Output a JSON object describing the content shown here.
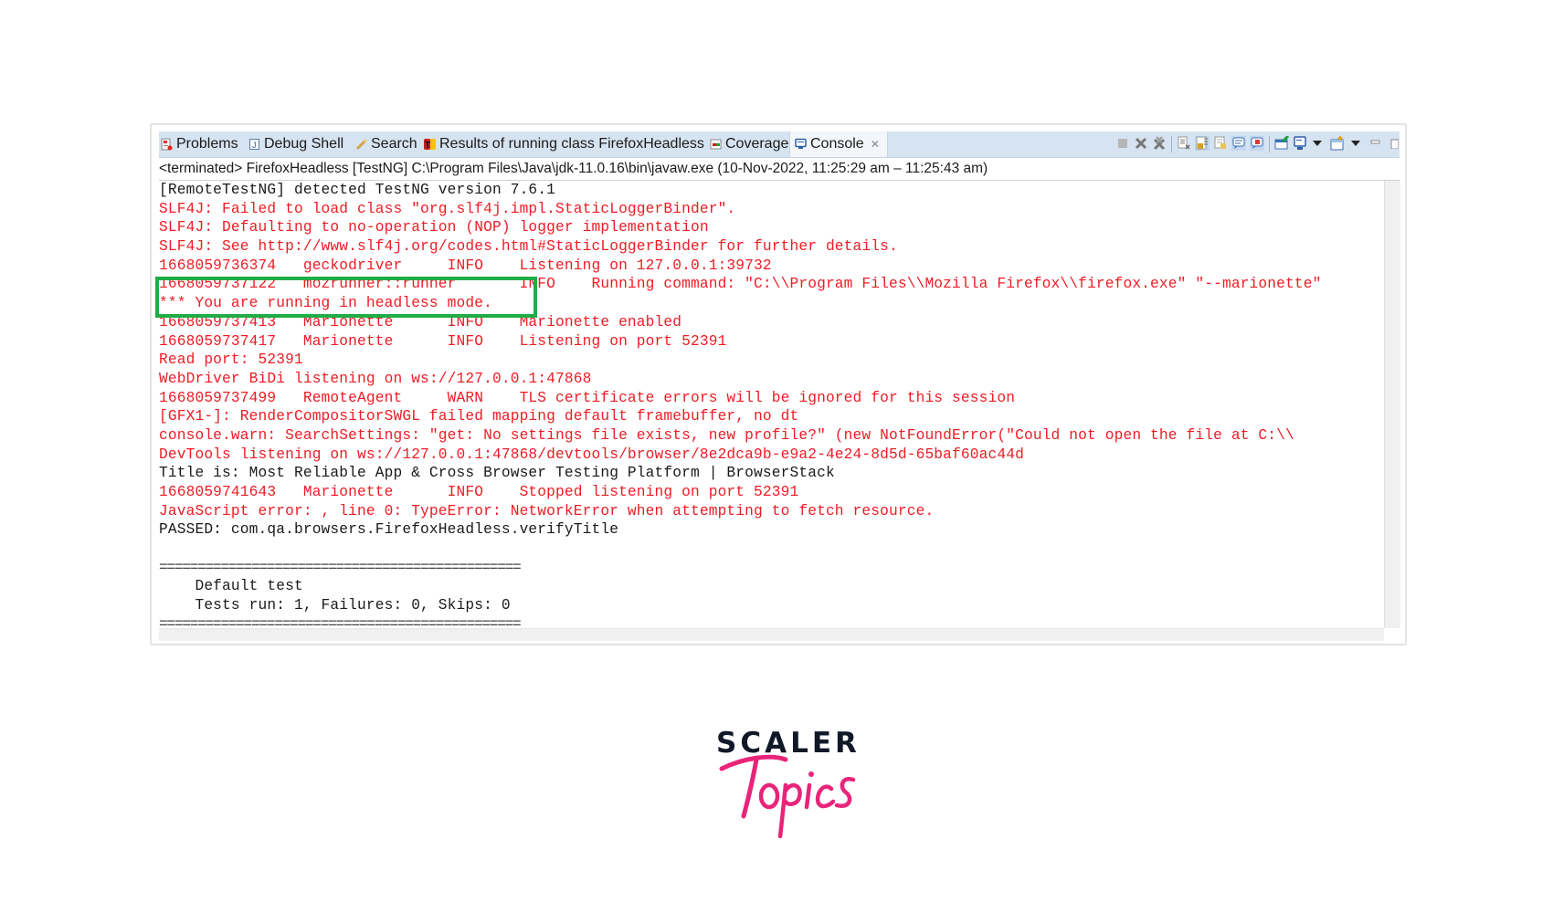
{
  "tabs": [
    {
      "label": "Problems",
      "icon": "problems-icon",
      "active": false
    },
    {
      "label": "Debug Shell",
      "icon": "debug-shell-icon",
      "active": false
    },
    {
      "label": "Search",
      "icon": "search-icon",
      "active": false
    },
    {
      "label": "Results of running class FirefoxHeadless",
      "icon": "testng-results-icon",
      "active": false
    },
    {
      "label": "Coverage",
      "icon": "coverage-icon",
      "active": false
    },
    {
      "label": "Console",
      "icon": "console-icon",
      "active": true,
      "close": "✕"
    }
  ],
  "toolbar": [
    {
      "name": "terminate-icon",
      "glyph": "■"
    },
    {
      "name": "remove-launch-icon",
      "glyph": "✖"
    },
    {
      "name": "remove-all-terminated-icon",
      "glyph": "✖"
    },
    {
      "name": "clear-console-icon",
      "glyph": "☰"
    },
    {
      "name": "scroll-lock-icon",
      "glyph": "☰"
    },
    {
      "name": "word-wrap-icon",
      "glyph": "☰"
    },
    {
      "name": "show-on-stdout-icon",
      "glyph": "▤"
    },
    {
      "name": "show-on-stderr-icon",
      "glyph": "▤"
    },
    {
      "name": "pin-console-icon",
      "glyph": "▬"
    },
    {
      "name": "display-console-icon",
      "glyph": "▣"
    },
    {
      "name": "display-console-dropdown-icon",
      "glyph": "▼"
    },
    {
      "name": "open-console-icon",
      "glyph": "□"
    },
    {
      "name": "open-console-dropdown-icon",
      "glyph": "▼"
    },
    {
      "name": "minimize-icon",
      "glyph": "−"
    },
    {
      "name": "maximize-icon",
      "glyph": "▯"
    }
  ],
  "status": "<terminated> FirefoxHeadless [TestNG] C:\\Program Files\\Java\\jdk-11.0.16\\bin\\javaw.exe  (10-Nov-2022, 11:25:29 am – 11:25:43 am)",
  "console_lines": [
    {
      "text": "[RemoteTestNG] detected TestNG version 7.6.1",
      "color": "black"
    },
    {
      "text": "SLF4J: Failed to load class \"org.slf4j.impl.StaticLoggerBinder\".",
      "color": "red"
    },
    {
      "text": "SLF4J: Defaulting to no-operation (NOP) logger implementation",
      "color": "red"
    },
    {
      "text": "SLF4J: See http://www.slf4j.org/codes.html#StaticLoggerBinder for further details.",
      "color": "red"
    },
    {
      "text": "1668059736374   geckodriver     INFO    Listening on 127.0.0.1:39732",
      "color": "red"
    },
    {
      "text": "1668059737122   mozrunner::runner       INFO    Running command: \"C:\\\\Program Files\\\\Mozilla Firefox\\\\firefox.exe\" \"--marionette\"",
      "color": "red"
    },
    {
      "text": "*** You are running in headless mode.",
      "color": "red"
    },
    {
      "text": "1668059737413   Marionette      INFO    Marionette enabled",
      "color": "red"
    },
    {
      "text": "1668059737417   Marionette      INFO    Listening on port 52391",
      "color": "red"
    },
    {
      "text": "Read port: 52391",
      "color": "red"
    },
    {
      "text": "WebDriver BiDi listening on ws://127.0.0.1:47868",
      "color": "red"
    },
    {
      "text": "1668059737499   RemoteAgent     WARN    TLS certificate errors will be ignored for this session",
      "color": "red"
    },
    {
      "text": "[GFX1-]: RenderCompositorSWGL failed mapping default framebuffer, no dt",
      "color": "red"
    },
    {
      "text": "console.warn: SearchSettings: \"get: No settings file exists, new profile?\" (new NotFoundError(\"Could not open the file at C:\\\\",
      "color": "red"
    },
    {
      "text": "DevTools listening on ws://127.0.0.1:47868/devtools/browser/8e2dca9b-e9a2-4e24-8d5d-65baf60ac44d",
      "color": "red"
    },
    {
      "text": "Title is: Most Reliable App & Cross Browser Testing Platform | BrowserStack",
      "color": "black"
    },
    {
      "text": "1668059741643   Marionette      INFO    Stopped listening on port 52391",
      "color": "red"
    },
    {
      "text": "JavaScript error: , line 0: TypeError: NetworkError when attempting to fetch resource.",
      "color": "red"
    },
    {
      "text": "PASSED: com.qa.browsers.FirefoxHeadless.verifyTitle",
      "color": "black"
    },
    {
      "text": "",
      "color": "black"
    },
    {
      "text": "===============================================",
      "color": "sep"
    },
    {
      "text": "    Default test",
      "color": "black"
    },
    {
      "text": "    Tests run: 1, Failures: 0, Skips: 0",
      "color": "black"
    },
    {
      "text": "===============================================",
      "color": "sep"
    }
  ],
  "highlight": {
    "label": "headless-mode-highlight",
    "color": "#1fad46"
  },
  "logo": {
    "line1": "SCALER",
    "line2": "Topics",
    "line1_color": "#111827",
    "line2_color": "#e8247a"
  }
}
